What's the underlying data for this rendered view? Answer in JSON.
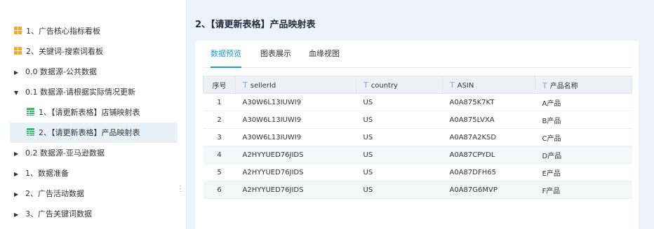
{
  "sidebar": {
    "items": [
      {
        "label": "1、广告核心指标看板",
        "icon": "dashboard-icon",
        "kind": "dash"
      },
      {
        "label": "2、关键词-搜索词看板",
        "icon": "dashboard-icon",
        "kind": "dash"
      },
      {
        "label": "0.0 数据源-公共数据",
        "icon": "caret-right-icon",
        "caret": "▶"
      },
      {
        "label": "0.1 数据源-请根据实际情况更新",
        "icon": "caret-down-icon",
        "caret": "▼"
      },
      {
        "label": "1、【请更新表格】店铺映射表",
        "icon": "table-icon",
        "kind": "table"
      },
      {
        "label": "2、【请更新表格】产品映射表",
        "icon": "table-icon",
        "kind": "table",
        "selected": true
      },
      {
        "label": "0.2 数据源-亚马逊数据",
        "icon": "caret-right-icon",
        "caret": "▶"
      },
      {
        "label": "1、数据准备",
        "icon": "caret-right-icon",
        "caret": "▶"
      },
      {
        "label": "2、广告活动数据",
        "icon": "caret-right-icon",
        "caret": "▶"
      },
      {
        "label": "3、广告关键词数据",
        "icon": "caret-right-icon",
        "caret": "▶"
      }
    ]
  },
  "main": {
    "title": "2、【请更新表格】产品映射表",
    "tabs": [
      {
        "label": "数据预览",
        "active": true
      },
      {
        "label": "图表展示"
      },
      {
        "label": "血缘视图"
      }
    ],
    "table": {
      "columns": [
        "序号",
        "sellerId",
        "country",
        "ASIN",
        "产品名称"
      ],
      "text_type_glyph": "T",
      "rows": [
        [
          "1",
          "A30W6L13IUWI9",
          "US",
          "A0A875K7KT",
          "A产品"
        ],
        [
          "2",
          "A30W6L13IUWI9",
          "US",
          "A0A875LVXA",
          "B产品"
        ],
        [
          "3",
          "A30W6L13IUWI9",
          "US",
          "A0A87A2KSD",
          "C产品"
        ],
        [
          "4",
          "A2HYYUED76JIDS",
          "US",
          "A0A87CPYDL",
          "D产品"
        ],
        [
          "5",
          "A2HYYUED76JIDS",
          "US",
          "A0A87DFH65",
          "E产品"
        ],
        [
          "6",
          "A2HYYUED76JIDS",
          "US",
          "A0A87G6MVP",
          "F产品"
        ]
      ]
    }
  },
  "colors": {
    "accent": "#1e9bd7",
    "dashboard": "#f5a623",
    "table": "#2fbf71",
    "selected_bg": "#e8f0f8"
  }
}
